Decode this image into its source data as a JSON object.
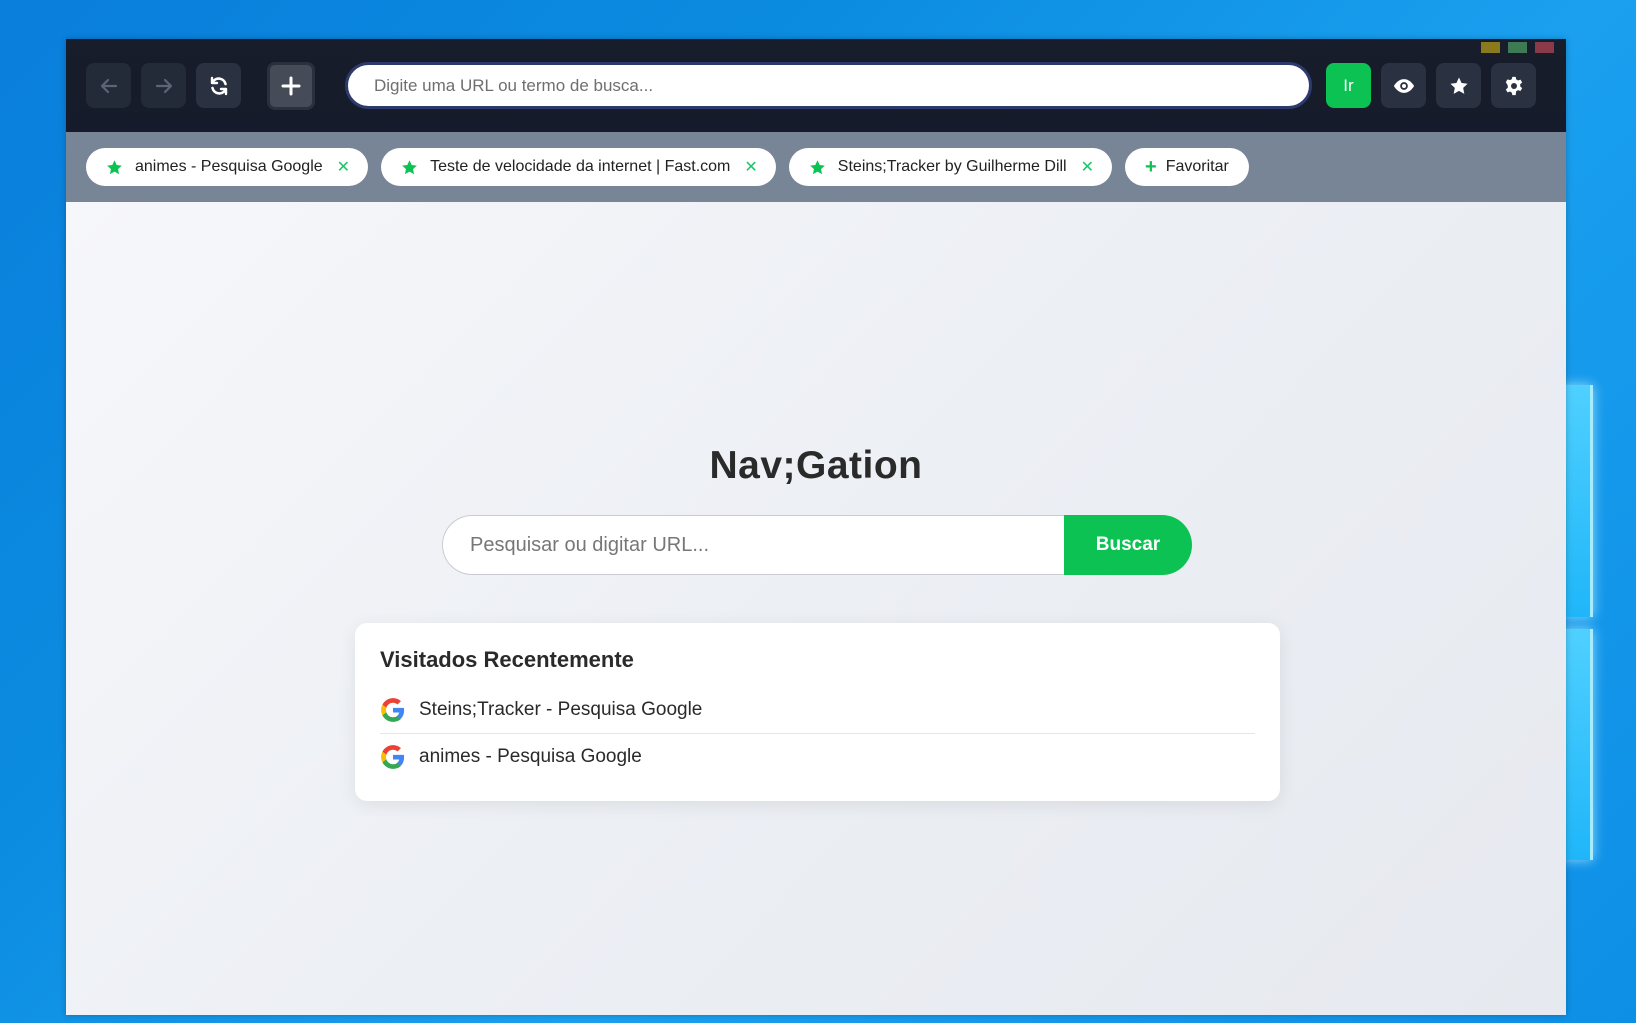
{
  "toolbar": {
    "back_icon": "arrow-left-icon",
    "forward_icon": "arrow-right-icon",
    "reload_icon": "reload-icon",
    "new_tab_icon": "plus-icon",
    "url_placeholder": "Digite uma URL ou termo de busca...",
    "go_label": "Ir",
    "privacy_icon": "eye-icon",
    "bookmark_icon": "star-icon",
    "settings_icon": "gear-icon"
  },
  "window_controls": {
    "minimize_color": "#8a7a1d",
    "maximize_color": "#3e7b54",
    "close_color": "#8a3a48"
  },
  "favorites": {
    "items": [
      {
        "label": "animes - Pesquisa Google",
        "remove": "✕"
      },
      {
        "label": "Teste de velocidade da internet | Fast.com",
        "remove": "✕"
      },
      {
        "label": "Steins;Tracker by Guilherme Dill",
        "remove": "✕"
      }
    ],
    "add_label": "Favoritar",
    "add_symbol": "+"
  },
  "home": {
    "brand": "Nav;Gation",
    "search_placeholder": "Pesquisar ou digitar URL...",
    "search_button": "Buscar"
  },
  "recent": {
    "title": "Visitados Recentemente",
    "items": [
      {
        "label": "Steins;Tracker - Pesquisa Google",
        "icon": "google-icon"
      },
      {
        "label": "animes - Pesquisa Google",
        "icon": "google-icon"
      }
    ]
  },
  "colors": {
    "accent": "#0bc252",
    "toolbar_bg": "#171d2a",
    "favbar_bg": "#778597"
  }
}
